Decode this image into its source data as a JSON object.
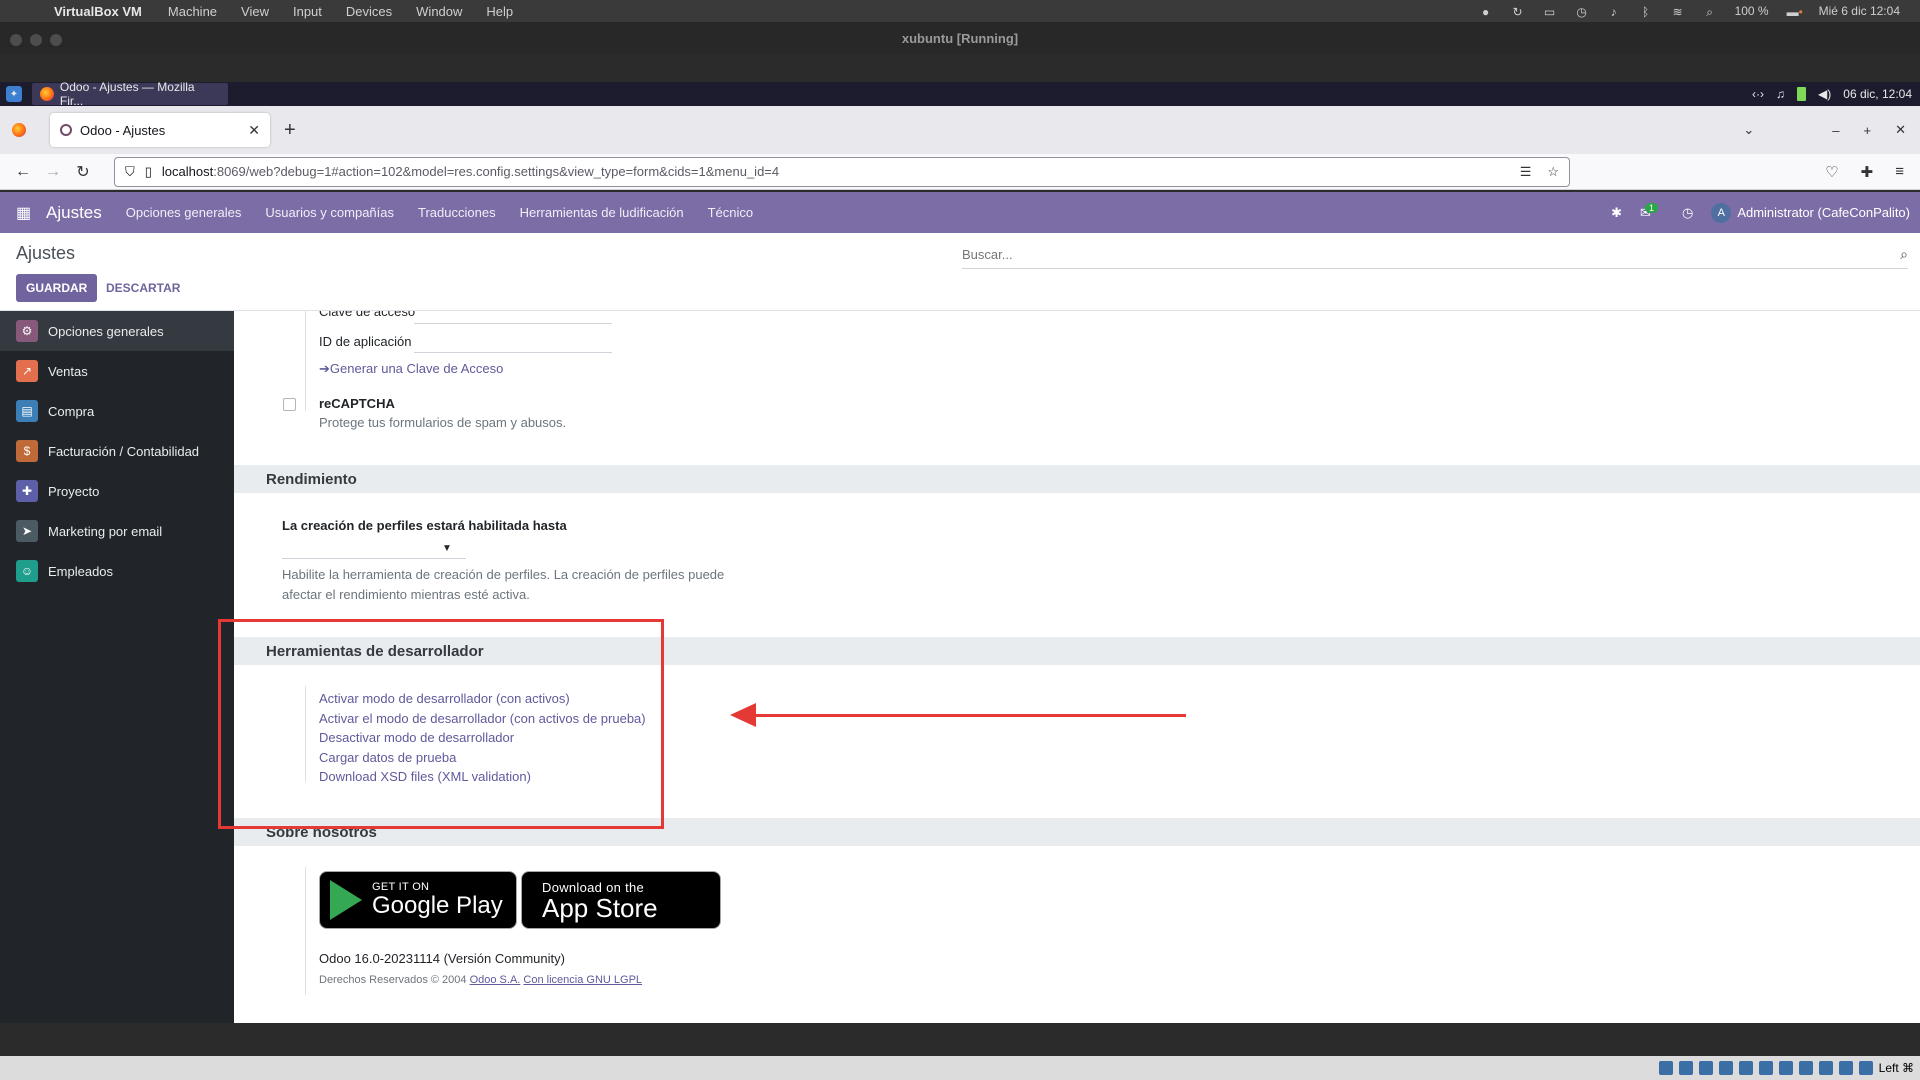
{
  "mac": {
    "app_name": "VirtualBox VM",
    "menus": [
      "Machine",
      "View",
      "Input",
      "Devices",
      "Window",
      "Help"
    ],
    "battery": "100 %",
    "datetime": "Mié 6 dic  12:04"
  },
  "vm": {
    "title": "xubuntu [Running]"
  },
  "xfce": {
    "task_label": "Odoo - Ajustes — Mozilla Fir...",
    "datetime": "06 dic, 12:04"
  },
  "browser": {
    "tab_title": "Odoo - Ajustes",
    "url_host": "localhost",
    "url_rest": ":8069/web?debug=1#action=102&model=res.config.settings&view_type=form&cids=1&menu_id=4"
  },
  "odoo_nav": {
    "brand": "Ajustes",
    "menus": [
      "Opciones generales",
      "Usuarios y compañías",
      "Traducciones",
      "Herramientas de ludificación",
      "Técnico"
    ],
    "chat_badge": "1",
    "user": "Administrator (CafeConPalito)",
    "avatar_letter": "A"
  },
  "control": {
    "title": "Ajustes",
    "search_placeholder": "Buscar...",
    "save_label": "GUARDAR",
    "discard_label": "DESCARTAR"
  },
  "sidebar": {
    "items": [
      {
        "label": "Opciones generales",
        "color": "#875A7B",
        "icon": "gear-icon"
      },
      {
        "label": "Ventas",
        "color": "#E46F4E",
        "icon": "chart-icon"
      },
      {
        "label": "Compra",
        "color": "#3B7FB6",
        "icon": "cart-icon"
      },
      {
        "label": "Facturación / Contabilidad",
        "color": "#C06A3A",
        "icon": "invoice-icon"
      },
      {
        "label": "Proyecto",
        "color": "#5D5FA8",
        "icon": "puzzle-icon"
      },
      {
        "label": "Marketing por email",
        "color": "#4B5A63",
        "icon": "send-icon"
      },
      {
        "label": "Empleados",
        "color": "#1F9E8E",
        "icon": "people-icon"
      }
    ]
  },
  "content": {
    "access_key_label": "Clave de acceso",
    "app_id_label": "ID de aplicación",
    "generate_key_link": "Generar una Clave de Acceso",
    "recaptcha_title": "reCAPTCHA",
    "recaptcha_desc": "Protege tus formularios de spam y abusos.",
    "performance_header": "Rendimiento",
    "profiling_label": "La creación de perfiles estará habilitada hasta",
    "profiling_desc_1": "Habilite la herramienta de creación de perfiles. La creación de perfiles puede",
    "profiling_desc_2": "afectar el rendimiento mientras esté activa.",
    "dev_header": "Herramientas de desarrollador",
    "dev_links": [
      "Activar modo de desarrollador (con activos)",
      "Activar el modo de desarrollador (con activos de prueba)",
      "Desactivar modo de desarrollador",
      "Cargar datos de prueba",
      "Download XSD files (XML validation)"
    ],
    "about_header": "Sobre nosotros",
    "google_small": "GET IT ON",
    "google_big": "Google Play",
    "apple_small": "Download on the",
    "apple_big": "App Store",
    "version": "Odoo 16.0-20231114 (Versión Community)",
    "copyright": "Derechos Reservados © 2004",
    "odoo_sa": "Odoo S.A.",
    "license": "Con licencia GNU LGPL"
  },
  "vbox_status": {
    "host_key": "Left ⌘"
  },
  "colors": {
    "odoo_purple": "#7c6da6",
    "annotation_red": "#e53935"
  }
}
